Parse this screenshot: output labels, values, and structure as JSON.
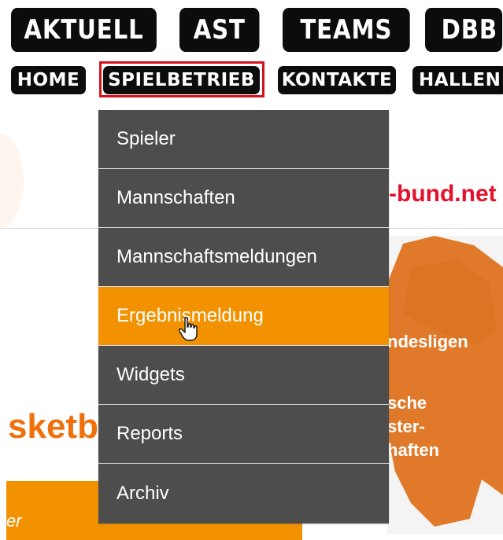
{
  "top_nav": {
    "primary": [
      "AKTUELL",
      "AST",
      "TEAMS",
      "DBB"
    ],
    "secondary": [
      "HOME",
      "SPIELBETRIEB",
      "KONTAKTE",
      "HALLEN"
    ]
  },
  "dropdown": {
    "items": [
      "Spieler",
      "Mannschaften",
      "Mannschaftsmeldungen",
      "Ergebnismeldung",
      "Widgets",
      "Reports",
      "Archiv"
    ],
    "active_index": 3
  },
  "background": {
    "site_link": "-bund.net",
    "map_labels": [
      "ndesligen",
      "sche",
      "ster-",
      "haften"
    ],
    "teaser": "sketba",
    "band_text": "er"
  },
  "colors": {
    "nav_bg": "#0c0c0c",
    "dropdown_bg": "#4d4d4d",
    "dropdown_active": "#f39200",
    "highlight": "#d6121b",
    "link_red": "#e3122c"
  },
  "icons": {
    "cursor": "hand-pointer-icon"
  }
}
